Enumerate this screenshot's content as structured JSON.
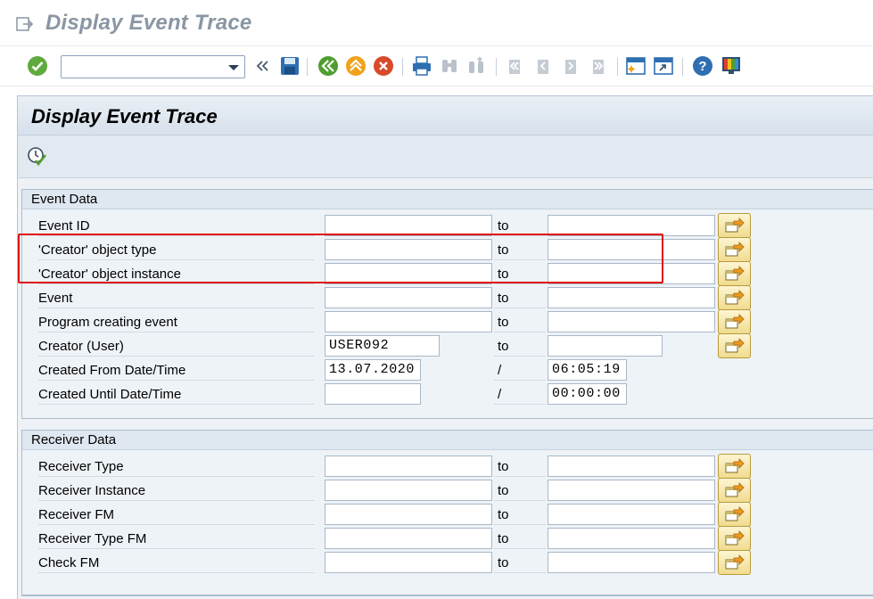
{
  "window": {
    "title": "Display Event Trace"
  },
  "toolbar": {
    "command_value": "",
    "icons": [
      "enter-icon",
      "back-icon",
      "save-icon",
      "back-green-icon",
      "exit-icon",
      "cancel-icon",
      "print-icon",
      "find-icon",
      "find-next-icon",
      "first-page-icon",
      "previous-page-icon",
      "next-page-icon",
      "last-page-icon",
      "create-session-icon",
      "shortcut-icon",
      "help-icon",
      "customize-layout-icon"
    ]
  },
  "screen": {
    "title": "Display Event Trace"
  },
  "event_data": {
    "title": "Event Data",
    "rows": [
      {
        "label": "Event ID",
        "from": "",
        "sep": "to",
        "to": ""
      },
      {
        "label": "'Creator' object type",
        "from": "",
        "sep": "to",
        "to": ""
      },
      {
        "label": "'Creator' object instance",
        "from": "",
        "sep": "to",
        "to": ""
      },
      {
        "label": "Event",
        "from": "",
        "sep": "to",
        "to": ""
      },
      {
        "label": "Program creating event",
        "from": "",
        "sep": "to",
        "to": ""
      },
      {
        "label": "Creator (User)",
        "from": "USER092",
        "sep": "to",
        "to": ""
      },
      {
        "label": "Created From Date/Time",
        "from": "13.07.2020",
        "sep": "/",
        "to": "06:05:19"
      },
      {
        "label": "Created Until Date/Time",
        "from": "",
        "sep": "/",
        "to": "00:00:00"
      }
    ]
  },
  "receiver_data": {
    "title": "Receiver Data",
    "rows": [
      {
        "label": "Receiver Type",
        "from": "",
        "sep": "to",
        "to": ""
      },
      {
        "label": "Receiver Instance",
        "from": "",
        "sep": "to",
        "to": ""
      },
      {
        "label": "Receiver FM",
        "from": "",
        "sep": "to",
        "to": ""
      },
      {
        "label": "Receiver Type FM",
        "from": "",
        "sep": "to",
        "to": ""
      },
      {
        "label": "Check FM",
        "from": "",
        "sep": "to",
        "to": ""
      }
    ]
  },
  "colors": {
    "highlight": "#e01010",
    "title_grey": "#8a96a3",
    "panel_bg": "#eef2f6"
  }
}
